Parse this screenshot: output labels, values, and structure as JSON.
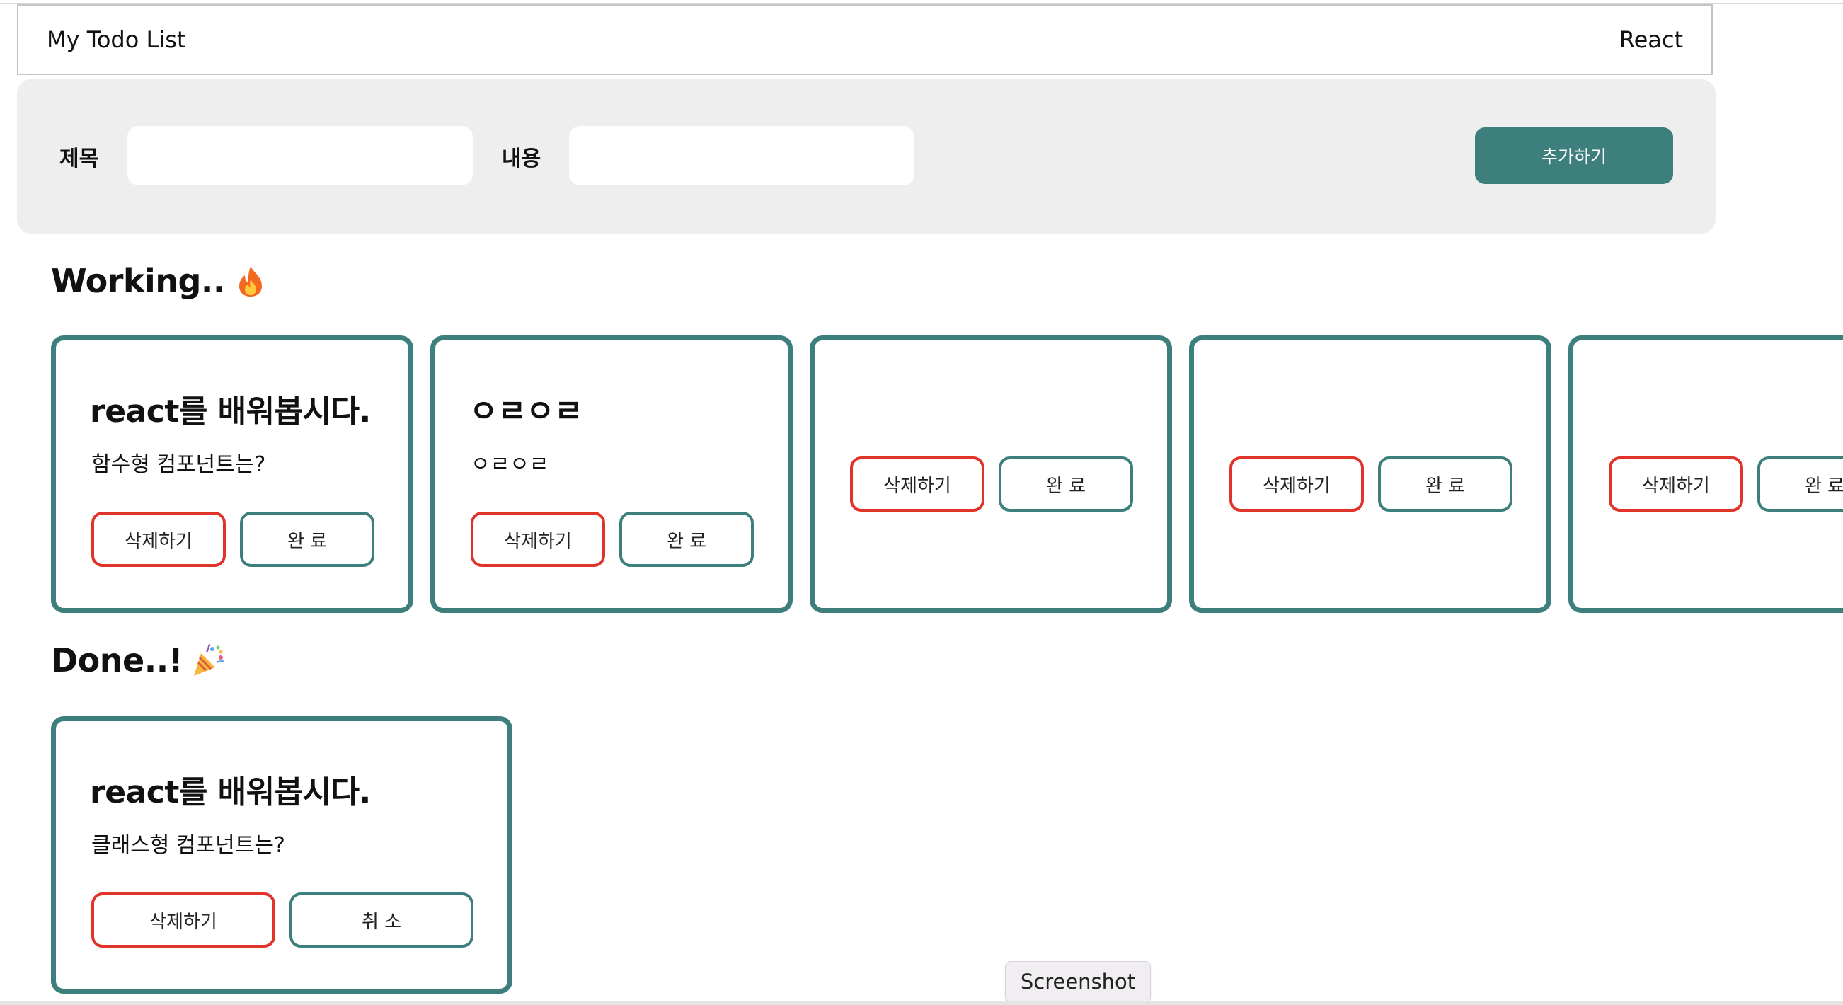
{
  "header": {
    "title": "My Todo List",
    "right_label": "React"
  },
  "form": {
    "title_label": "제목",
    "title_value": "",
    "content_label": "내용",
    "content_value": "",
    "add_button_label": "추가하기"
  },
  "working": {
    "heading": "Working..",
    "emoji": "fire-icon",
    "cards": [
      {
        "title": "react를 배워봅시다.",
        "body": "함수형 컴포넌트는?",
        "delete_label": "삭제하기",
        "done_label": "완 료"
      },
      {
        "title": "ㅇㄹㅇㄹ",
        "body": "ㅇㄹㅇㄹ",
        "delete_label": "삭제하기",
        "done_label": "완 료"
      },
      {
        "title": "",
        "body": "",
        "delete_label": "삭제하기",
        "done_label": "완 료"
      },
      {
        "title": "",
        "body": "",
        "delete_label": "삭제하기",
        "done_label": "완 료"
      },
      {
        "title": "",
        "body": "",
        "delete_label": "삭제하기",
        "done_label": "완 료"
      }
    ]
  },
  "done": {
    "heading": "Done..!",
    "emoji": "party-popper-icon",
    "cards": [
      {
        "title": "react를 배워봅시다.",
        "body": "클래스형 컴포넌트는?",
        "delete_label": "삭제하기",
        "cancel_label": "취 소"
      }
    ]
  },
  "tooltip": {
    "label": "Screenshot"
  },
  "colors": {
    "accent": "#3d7f7c",
    "delete_border": "#e0342a",
    "form_background": "#eeeeee"
  }
}
